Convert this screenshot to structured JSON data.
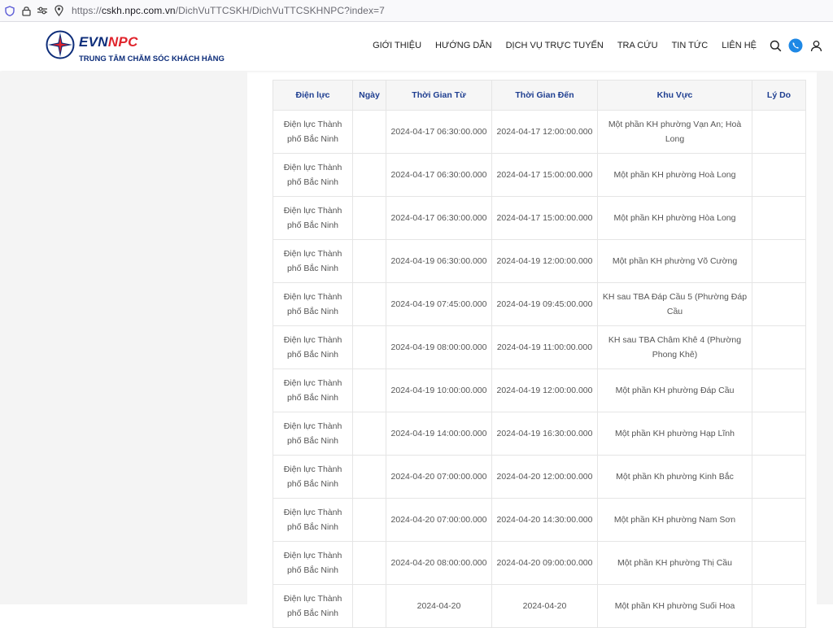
{
  "browser": {
    "url_prefix": "https://",
    "url_host": "cskh.npc.com.vn",
    "url_path": "/DichVuTTCSKH/DichVuTTCSKHNPC?index=7"
  },
  "header": {
    "logo_evn": "EVN",
    "logo_npc": "NPC",
    "logo_subtitle": "TRUNG TÂM CHĂM SÓC KHÁCH HÀNG",
    "nav": [
      "GIỚI THIỆU",
      "HƯỚNG DẪN",
      "DỊCH VỤ TRỰC TUYẾN",
      "TRA CỨU",
      "TIN TỨC",
      "LIÊN HỆ"
    ],
    "icons": [
      "search-icon",
      "phone-icon",
      "user-icon"
    ],
    "colors": {
      "brand_blue": "#0d2d7a",
      "brand_red": "#e0242c",
      "phone_accent": "#1e88e5"
    }
  },
  "table": {
    "headers": [
      "Điện lực",
      "Ngày",
      "Thời Gian Từ",
      "Thời Gian Đến",
      "Khu Vực",
      "Lý Do"
    ],
    "rows": [
      [
        "Điện lực Thành phố Bắc Ninh",
        "",
        "2024-04-17 06:30:00.000",
        "2024-04-17 12:00:00.000",
        "Một phần KH phường Vạn An; Hoà Long",
        ""
      ],
      [
        "Điện lực Thành phố Bắc Ninh",
        "",
        "2024-04-17 06:30:00.000",
        "2024-04-17 15:00:00.000",
        "Một phần KH phường Hoà Long",
        ""
      ],
      [
        "Điện lực Thành phố Bắc Ninh",
        "",
        "2024-04-17 06:30:00.000",
        "2024-04-17 15:00:00.000",
        "Một phần KH phường Hòa Long",
        ""
      ],
      [
        "Điện lực Thành phố Bắc Ninh",
        "",
        "2024-04-19 06:30:00.000",
        "2024-04-19 12:00:00.000",
        "Một phần KH phường Võ Cường",
        ""
      ],
      [
        "Điện lực Thành phố Bắc Ninh",
        "",
        "2024-04-19 07:45:00.000",
        "2024-04-19 09:45:00.000",
        "KH sau TBA Đáp Cầu 5 (Phường Đáp Cầu",
        ""
      ],
      [
        "Điện lực Thành phố Bắc Ninh",
        "",
        "2024-04-19 08:00:00.000",
        "2024-04-19 11:00:00.000",
        "KH sau TBA Châm Khê 4 (Phường Phong Khê)",
        ""
      ],
      [
        "Điện lực Thành phố Bắc Ninh",
        "",
        "2024-04-19 10:00:00.000",
        "2024-04-19 12:00:00.000",
        "Một phần KH phường Đáp Cầu",
        ""
      ],
      [
        "Điện lực Thành phố Bắc Ninh",
        "",
        "2024-04-19 14:00:00.000",
        "2024-04-19 16:30:00.000",
        "Một phần KH phường Hạp Lĩnh",
        ""
      ],
      [
        "Điện lực Thành phố Bắc Ninh",
        "",
        "2024-04-20 07:00:00.000",
        "2024-04-20 12:00:00.000",
        "Một phần Kh phường Kinh Bắc",
        ""
      ],
      [
        "Điện lực Thành phố Bắc Ninh",
        "",
        "2024-04-20 07:00:00.000",
        "2024-04-20 14:30:00.000",
        "Một phần KH phường Nam Sơn",
        ""
      ],
      [
        "Điện lực Thành phố Bắc Ninh",
        "",
        "2024-04-20 08:00:00.000",
        "2024-04-20 09:00:00.000",
        "Một phần KH phường Thị Cầu",
        ""
      ],
      [
        "Điện lực Thành phố Bắc Ninh",
        "",
        "2024-04-20",
        "2024-04-20",
        "Một phần KH phường Suối Hoa",
        ""
      ]
    ]
  }
}
